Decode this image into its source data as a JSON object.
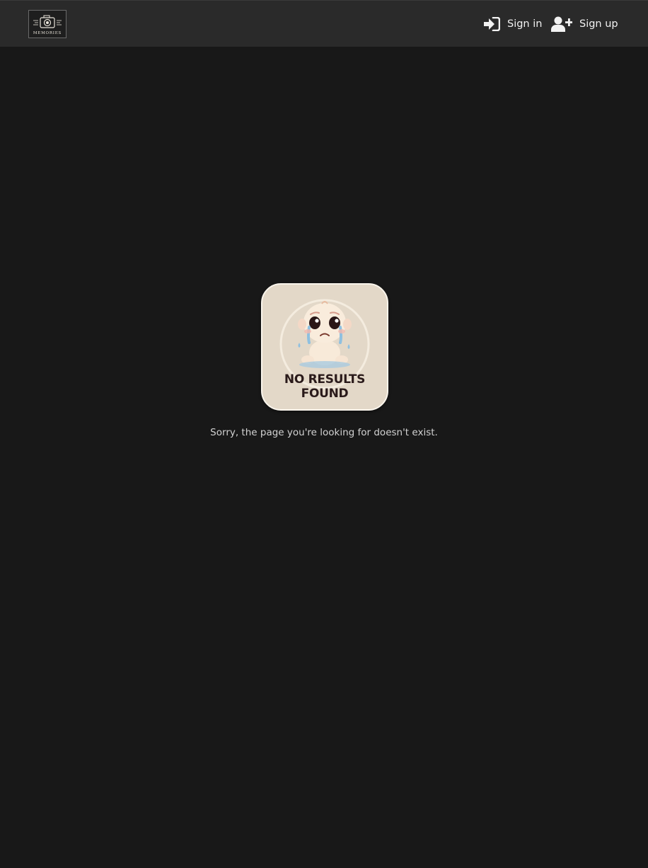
{
  "header": {
    "logo_text": "MEMORIES",
    "signin_label": "Sign in",
    "signup_label": "Sign up",
    "icons": {
      "signin": "sign-in-icon",
      "signup": "user-plus-icon",
      "logo": "camera-icon"
    }
  },
  "notfound": {
    "image_line1": "NO RESULTS",
    "image_line2": "FOUND",
    "message": "Sorry, the page you're looking for doesn't exist."
  },
  "colors": {
    "background": "#181818",
    "navbar": "#2a2a2a",
    "text": "#f2f2f2",
    "card": "#e3d8c8"
  }
}
